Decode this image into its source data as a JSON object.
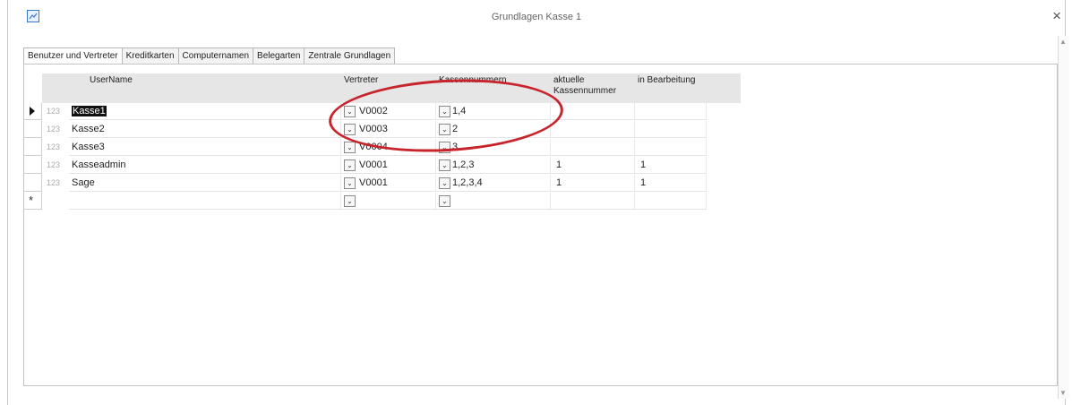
{
  "window": {
    "title": "Grundlagen Kasse 1",
    "close_symbol": "×",
    "app_icon": "chart-icon"
  },
  "tabs": [
    {
      "label": "Benutzer und Vertreter",
      "active": true
    },
    {
      "label": "Kreditkarten",
      "active": false
    },
    {
      "label": "Computernamen",
      "active": false
    },
    {
      "label": "Belegarten",
      "active": false
    },
    {
      "label": "Zentrale Grundlagen",
      "active": false
    }
  ],
  "grid": {
    "columns": [
      "UserName",
      "Vertreter",
      "Kassennummern",
      "aktuelle Kassennummer",
      "in Bearbeitung"
    ],
    "rows": [
      {
        "num": "123",
        "username": "Kasse1",
        "vertreter": "V0002",
        "kassennummern": "1,4",
        "aktuelle": "",
        "bearbeitung": "",
        "current": true
      },
      {
        "num": "123",
        "username": "Kasse2",
        "vertreter": "V0003",
        "kassennummern": "2",
        "aktuelle": "",
        "bearbeitung": ""
      },
      {
        "num": "123",
        "username": "Kasse3",
        "vertreter": "V0004",
        "kassennummern": "3",
        "aktuelle": "",
        "bearbeitung": ""
      },
      {
        "num": "123",
        "username": "Kasseadmin",
        "vertreter": "V0001",
        "kassennummern": "1,2,3",
        "aktuelle": "1",
        "bearbeitung": "1"
      },
      {
        "num": "123",
        "username": "Sage",
        "vertreter": "V0001",
        "kassennummern": "1,2,3,4",
        "aktuelle": "1",
        "bearbeitung": "1"
      }
    ],
    "new_row_symbol": "*",
    "dropdown_symbol": "⌄"
  },
  "annotation": {
    "color": "#c8242b"
  }
}
